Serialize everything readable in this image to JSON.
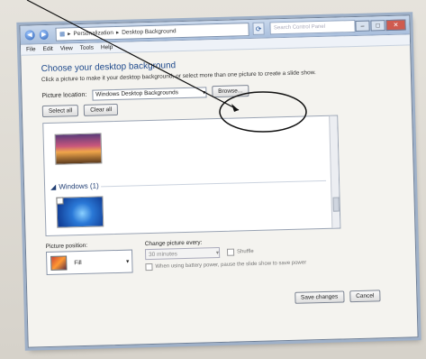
{
  "window": {
    "breadcrumb": [
      "Personalization",
      "Desktop Background"
    ],
    "search_placeholder": "Search Control Panel",
    "controls": [
      "–",
      "□",
      "✕"
    ]
  },
  "menu": [
    "File",
    "Edit",
    "View",
    "Tools",
    "Help"
  ],
  "main": {
    "heading": "Choose your desktop background",
    "subtitle": "Click a picture to make it your desktop background, or select more than one picture to create a slide show.",
    "picture_location_label": "Picture location:",
    "picture_location_value": "Windows Desktop Backgrounds",
    "browse_label": "Browse...",
    "select_all_label": "Select all",
    "clear_all_label": "Clear all",
    "group_label": "Windows (1)"
  },
  "position": {
    "label": "Picture position:",
    "value": "Fill"
  },
  "change": {
    "label": "Change picture every:",
    "interval": "30 minutes",
    "shuffle_label": "Shuffle",
    "battery_label": "When using battery power, pause the slide show to save power"
  },
  "footer": {
    "save_label": "Save changes",
    "cancel_label": "Cancel"
  }
}
